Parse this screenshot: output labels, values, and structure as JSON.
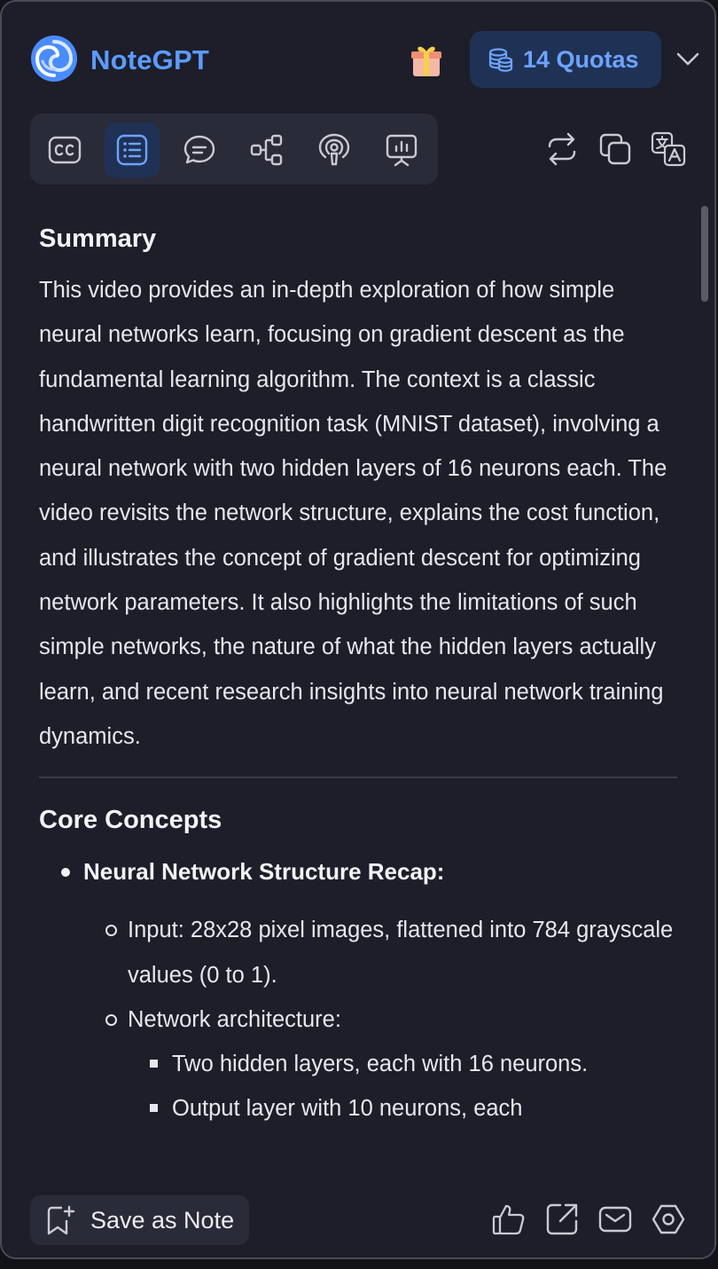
{
  "app": {
    "name": "NoteGPT",
    "quota_label": "14 Quotas"
  },
  "toolbar": {
    "tabs": [
      {
        "icon": "closed-captions-icon",
        "active": false
      },
      {
        "icon": "list-summary-icon",
        "active": true
      },
      {
        "icon": "chat-bubble-icon",
        "active": false
      },
      {
        "icon": "mind-map-icon",
        "active": false
      },
      {
        "icon": "podcast-icon",
        "active": false
      },
      {
        "icon": "presentation-icon",
        "active": false
      }
    ],
    "actions": [
      "regenerate-icon",
      "copy-icon",
      "translate-icon"
    ]
  },
  "content": {
    "summary_heading": "Summary",
    "summary_text": "This video provides an in-depth exploration of how simple neural networks learn, focusing on gradient descent as the fundamental learning algorithm. The context is a classic handwritten digit recognition task (MNIST dataset), involving a neural network with two hidden layers of 16 neurons each. The video revisits the network structure, explains the cost function, and illustrates the concept of gradient descent for optimizing network parameters. It also highlights the limitations of such simple networks, the nature of what the hidden layers actually learn, and recent research insights into neural network training dynamics.",
    "core_heading": "Core Concepts",
    "core_item_title": "Neural Network Structure Recap:",
    "sub_items": [
      "Input: 28x28 pixel images, flattened into 784 grayscale values (0 to 1).",
      "Network architecture:"
    ],
    "sub_sub_items": [
      "Two hidden layers, each with 16 neurons.",
      "Output layer with 10 neurons, each"
    ]
  },
  "footer": {
    "save_label": "Save as Note",
    "icons": [
      "thumbs-up-icon",
      "share-icon",
      "email-icon",
      "settings-icon"
    ]
  },
  "colors": {
    "accent": "#5c9bff",
    "panel_bg": "#1d1e2a",
    "active_bg": "#1f3256"
  }
}
